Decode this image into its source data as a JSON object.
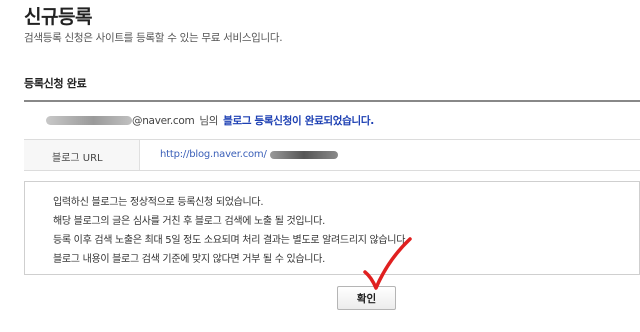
{
  "header": {
    "title": "신규등록",
    "description": "검색등록 신청은 사이트를 등록할 수 있는 무료 서비스입니다."
  },
  "section": {
    "title": "등록신청 완료"
  },
  "result": {
    "email_suffix": "@naver.com",
    "email_particle": "님의",
    "completion_message": "블로그 등록신청이 완료되었습니다.",
    "url_label": "블로그 URL",
    "url_value": "http://blog.naver.com/"
  },
  "notice": {
    "lines": [
      "입력하신 블로그는 정상적으로 등록신청 되었습니다.",
      "해당 블로그의 글은 심사를 거친 후 블로그 검색에 노출 될 것입니다.",
      "등록 이후 검색 노출은 최대 5일 정도 소요되며 처리 결과는 별도로 알려드리지 않습니다.",
      "블로그 내용이 블로그 검색 기준에 맞지 않다면 거부 될 수 있습니다."
    ]
  },
  "actions": {
    "confirm_label": "확인"
  },
  "colors": {
    "highlight_text": "#1d40b3",
    "link_text": "#3a5fb8",
    "annotation_red": "#e02020"
  },
  "annotation": {
    "icon": "red-checkmark-icon"
  }
}
